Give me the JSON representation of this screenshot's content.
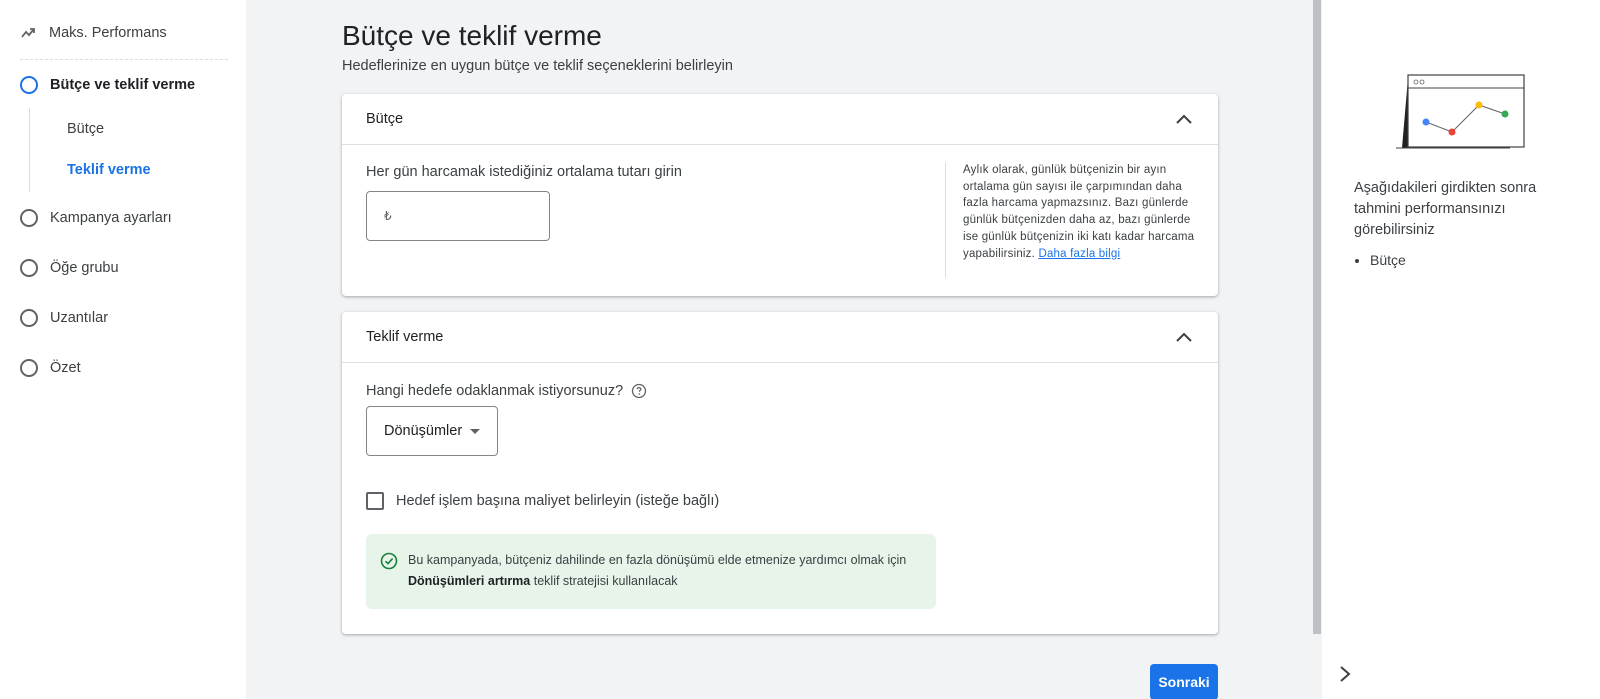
{
  "leftnav": {
    "top_item": "Maks. Performans",
    "steps": [
      {
        "label": "Bütçe ve teklif verme",
        "active": true
      },
      {
        "label": "Kampanya ayarları"
      },
      {
        "label": "Öğe grubu"
      },
      {
        "label": "Uzantılar"
      },
      {
        "label": "Özet"
      }
    ],
    "substeps": [
      {
        "label": "Bütçe"
      },
      {
        "label": "Teklif verme",
        "active": true
      }
    ]
  },
  "main": {
    "title": "Bütçe ve teklif verme",
    "subtitle": "Hedeflerinize en uygun bütçe ve teklif seçeneklerini belirleyin",
    "budget": {
      "header": "Bütçe",
      "label": "Her gün harcamak istediğiniz ortalama tutarı girin",
      "currency": "₺",
      "value": "",
      "help_text": "Aylık olarak, günlük bütçenizin bir ayın ortalama gün sayısı ile çarpımından daha fazla harcama yapmazsınız. Bazı günlerde günlük bütçenizden daha az, bazı günlerde ise günlük bütçenizin iki katı kadar harcama yapabilirsiniz.",
      "help_link": "Daha fazla bilgi"
    },
    "bidding": {
      "header": "Teklif verme",
      "question": "Hangi hedefe odaklanmak istiyorsunuz?",
      "dropdown_value": "Dönüşümler",
      "checkbox_label": "Hedef işlem başına maliyet belirleyin (isteğe bağlı)",
      "info_part1": "Bu kampanyada, bütçeniz dahilinde en fazla dönüşümü elde etmenize yardımcı olmak için",
      "info_bold": "Dönüşümleri artırma",
      "info_part2": "teklif stratejisi kullanılacak"
    },
    "next_button": "Sonraki"
  },
  "rightpanel": {
    "text": "Aşağıdakileri girdikten sonra tahmini performansınızı görebilirsiniz",
    "items": [
      "Bütçe"
    ]
  },
  "colors": {
    "accent": "#1a73e8",
    "info_bg": "#e6f4ea",
    "success": "#188038"
  }
}
